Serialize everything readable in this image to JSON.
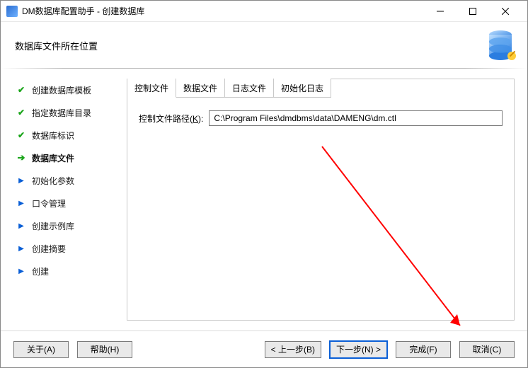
{
  "titlebar": {
    "title": "DM数据库配置助手 - 创建数据库"
  },
  "header": {
    "subtitle": "数据库文件所在位置"
  },
  "sidebar": {
    "steps": [
      {
        "label": "创建数据库模板",
        "state": "done"
      },
      {
        "label": "指定数据库目录",
        "state": "done"
      },
      {
        "label": "数据库标识",
        "state": "done"
      },
      {
        "label": "数据库文件",
        "state": "current"
      },
      {
        "label": "初始化参数",
        "state": "pending"
      },
      {
        "label": "口令管理",
        "state": "pending"
      },
      {
        "label": "创建示例库",
        "state": "pending"
      },
      {
        "label": "创建摘要",
        "state": "pending"
      },
      {
        "label": "创建",
        "state": "pending"
      }
    ]
  },
  "main": {
    "tabs": [
      {
        "label": "控制文件",
        "active": true
      },
      {
        "label": "数据文件",
        "active": false
      },
      {
        "label": "日志文件",
        "active": false
      },
      {
        "label": "初始化日志",
        "active": false
      }
    ],
    "field": {
      "label_pre": "控制文件路径(",
      "label_key": "K",
      "label_post": "):",
      "value": "C:\\Program Files\\dmdbms\\data\\DAMENG\\dm.ctl"
    }
  },
  "footer": {
    "about": "关于(A)",
    "help": "帮助(H)",
    "back": "< 上一步(B)",
    "next": "下一步(N) >",
    "finish": "完成(F)",
    "cancel": "取消(C)"
  }
}
